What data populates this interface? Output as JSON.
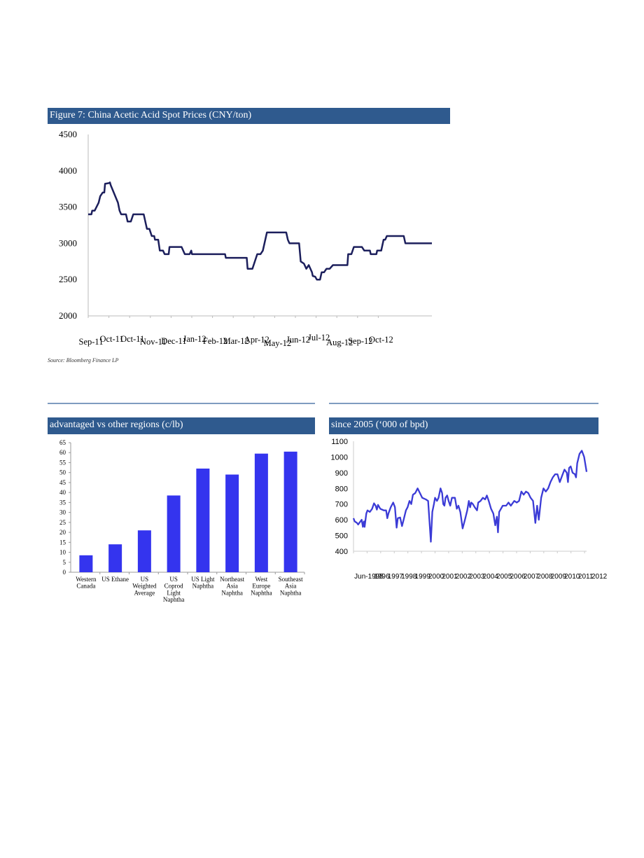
{
  "figure7": {
    "header": "Figure 7: China Acetic Acid Spot Prices (CNY/ton)",
    "source": "Source: Bloomberg Finance LP"
  },
  "figure_left": {
    "header": "advantaged vs other regions (c/lb)"
  },
  "figure_right": {
    "header": "since 2005 (‘000 of bpd)"
  },
  "colors": {
    "header": "#2f5a8e",
    "line_dark": "#1c1f5c",
    "bars": "#3434ee",
    "line_blue": "#3b3bd6"
  },
  "chart_data": [
    {
      "type": "line",
      "title": "Figure 7: China Acetic Acid Spot Prices (CNY/ton)",
      "ylim": [
        2000,
        4500
      ],
      "yticks": [
        2000,
        2500,
        3000,
        3500,
        4000,
        4500
      ],
      "xlim": [
        "2011-09-01",
        "2012-11-01"
      ],
      "xtick_labels": [
        "Sep-11",
        "Oct-11",
        "Oct-11",
        "Nov-11",
        "Dec-11",
        "Jan-12",
        "Feb-12",
        "Mar-12",
        "Apr-12",
        "May-12",
        "Jun-12",
        "Jul-12",
        "Aug-12",
        "Sep-12",
        "Oct-12"
      ],
      "grid": false,
      "points": [
        [
          "2011-09-01",
          3400
        ],
        [
          "2011-09-05",
          3400
        ],
        [
          "2011-09-06",
          3450
        ],
        [
          "2011-09-09",
          3450
        ],
        [
          "2011-09-14",
          3560
        ],
        [
          "2011-09-16",
          3650
        ],
        [
          "2011-09-19",
          3700
        ],
        [
          "2011-09-21",
          3700
        ],
        [
          "2011-09-22",
          3820
        ],
        [
          "2011-09-27",
          3830
        ],
        [
          "2011-09-28",
          3840
        ],
        [
          "2011-09-29",
          3800
        ],
        [
          "2011-10-08",
          3560
        ],
        [
          "2011-10-10",
          3450
        ],
        [
          "2011-10-12",
          3400
        ],
        [
          "2011-10-18",
          3400
        ],
        [
          "2011-10-20",
          3300
        ],
        [
          "2011-10-24",
          3300
        ],
        [
          "2011-10-27",
          3400
        ],
        [
          "2011-11-09",
          3400
        ],
        [
          "2011-11-13",
          3200
        ],
        [
          "2011-11-16",
          3200
        ],
        [
          "2011-11-19",
          3100
        ],
        [
          "2011-11-22",
          3100
        ],
        [
          "2011-11-23",
          3050
        ],
        [
          "2011-11-27",
          3050
        ],
        [
          "2011-11-29",
          2900
        ],
        [
          "2011-12-03",
          2900
        ],
        [
          "2011-12-05",
          2850
        ],
        [
          "2011-12-10",
          2850
        ],
        [
          "2011-12-11",
          2950
        ],
        [
          "2011-12-26",
          2950
        ],
        [
          "2011-12-30",
          2850
        ],
        [
          "2012-01-05",
          2850
        ],
        [
          "2012-01-07",
          2900
        ],
        [
          "2012-01-08",
          2850
        ],
        [
          "2012-02-18",
          2850
        ],
        [
          "2012-02-19",
          2800
        ],
        [
          "2012-03-16",
          2800
        ],
        [
          "2012-03-17",
          2650
        ],
        [
          "2012-03-23",
          2650
        ],
        [
          "2012-03-29",
          2850
        ],
        [
          "2012-04-02",
          2850
        ],
        [
          "2012-04-05",
          2900
        ],
        [
          "2012-04-10",
          3150
        ],
        [
          "2012-05-04",
          3150
        ],
        [
          "2012-05-06",
          3050
        ],
        [
          "2012-05-08",
          3000
        ],
        [
          "2012-05-20",
          3000
        ],
        [
          "2012-05-22",
          2750
        ],
        [
          "2012-05-26",
          2720
        ],
        [
          "2012-05-29",
          2650
        ],
        [
          "2012-06-01",
          2700
        ],
        [
          "2012-06-05",
          2600
        ],
        [
          "2012-06-06",
          2550
        ],
        [
          "2012-06-09",
          2540
        ],
        [
          "2012-06-11",
          2500
        ],
        [
          "2012-06-15",
          2500
        ],
        [
          "2012-06-17",
          2600
        ],
        [
          "2012-06-20",
          2600
        ],
        [
          "2012-06-23",
          2650
        ],
        [
          "2012-06-27",
          2650
        ],
        [
          "2012-07-01",
          2700
        ],
        [
          "2012-07-19",
          2700
        ],
        [
          "2012-07-20",
          2850
        ],
        [
          "2012-07-24",
          2850
        ],
        [
          "2012-07-27",
          2950
        ],
        [
          "2012-08-06",
          2950
        ],
        [
          "2012-08-09",
          2900
        ],
        [
          "2012-08-16",
          2900
        ],
        [
          "2012-08-17",
          2850
        ],
        [
          "2012-08-24",
          2850
        ],
        [
          "2012-08-25",
          2900
        ],
        [
          "2012-08-30",
          2900
        ],
        [
          "2012-09-02",
          3050
        ],
        [
          "2012-09-04",
          3050
        ],
        [
          "2012-09-06",
          3100
        ],
        [
          "2012-09-27",
          3100
        ],
        [
          "2012-09-29",
          3000
        ],
        [
          "2012-11-01",
          3000
        ]
      ]
    },
    {
      "type": "bar",
      "title": "advantaged vs other regions (c/lb)",
      "ylim": [
        0,
        65
      ],
      "yticks": [
        0,
        5,
        10,
        15,
        20,
        25,
        30,
        35,
        40,
        45,
        50,
        55,
        60,
        65
      ],
      "categories": [
        [
          "Western",
          "Canada"
        ],
        [
          "US Ethane"
        ],
        [
          "US",
          "Weighted",
          "Average"
        ],
        [
          "US",
          "Coprod",
          "Light",
          "Naphtha"
        ],
        [
          "US Light",
          "Naphtha"
        ],
        [
          "Northeast",
          "Asia",
          "Naphtha"
        ],
        [
          "West",
          "Europe",
          "Naphtha"
        ],
        [
          "Southeast",
          "Asia",
          "Naphtha"
        ]
      ],
      "values": [
        8.5,
        14,
        21,
        38.5,
        52,
        49,
        59.5,
        60.5
      ]
    },
    {
      "type": "line",
      "title": "since 2005 (‘000 of bpd)",
      "ylim": [
        400,
        1100
      ],
      "yticks": [
        400,
        500,
        600,
        700,
        800,
        900,
        1000,
        1100
      ],
      "xlim": [
        1995.4,
        2012.55
      ],
      "xtick_labels": [
        "Jun-1995",
        "1996",
        "1997",
        "1998",
        "1999",
        "2000",
        "2001",
        "2002",
        "2003",
        "2004",
        "2005",
        "2006",
        "2007",
        "2008",
        "2009",
        "2010",
        "2011",
        "2012"
      ],
      "points": [
        [
          1995.4,
          610
        ],
        [
          1995.49,
          590
        ],
        [
          1995.66,
          580
        ],
        [
          1995.74,
          570
        ],
        [
          1995.91,
          590
        ],
        [
          1996.0,
          600
        ],
        [
          1996.09,
          555
        ],
        [
          1996.17,
          590
        ],
        [
          1996.22,
          555
        ],
        [
          1996.34,
          640
        ],
        [
          1996.43,
          660
        ],
        [
          1996.6,
          650
        ],
        [
          1996.77,
          670
        ],
        [
          1996.91,
          705
        ],
        [
          1997.03,
          690
        ],
        [
          1997.12,
          665
        ],
        [
          1997.2,
          695
        ],
        [
          1997.37,
          670
        ],
        [
          1997.63,
          660
        ],
        [
          1997.8,
          660
        ],
        [
          1997.89,
          610
        ],
        [
          1997.97,
          640
        ],
        [
          1998.14,
          680
        ],
        [
          1998.32,
          710
        ],
        [
          1998.45,
          680
        ],
        [
          1998.57,
          550
        ],
        [
          1998.66,
          610
        ],
        [
          1998.83,
          615
        ],
        [
          1998.97,
          560
        ],
        [
          1999.09,
          600
        ],
        [
          1999.26,
          660
        ],
        [
          1999.38,
          680
        ],
        [
          1999.52,
          720
        ],
        [
          1999.65,
          700
        ],
        [
          1999.77,
          760
        ],
        [
          1999.94,
          770
        ],
        [
          2000.12,
          800
        ],
        [
          2000.29,
          770
        ],
        [
          2000.46,
          740
        ],
        [
          2000.72,
          730
        ],
        [
          2000.89,
          720
        ],
        [
          2001.09,
          460
        ],
        [
          2001.2,
          650
        ],
        [
          2001.32,
          700
        ],
        [
          2001.4,
          740
        ],
        [
          2001.54,
          720
        ],
        [
          2001.66,
          740
        ],
        [
          2001.8,
          800
        ],
        [
          2001.92,
          770
        ],
        [
          2002.0,
          700
        ],
        [
          2002.09,
          690
        ],
        [
          2002.17,
          740
        ],
        [
          2002.29,
          755
        ],
        [
          2002.4,
          720
        ],
        [
          2002.52,
          690
        ],
        [
          2002.64,
          740
        ],
        [
          2002.86,
          740
        ],
        [
          2003.0,
          670
        ],
        [
          2003.12,
          690
        ],
        [
          2003.26,
          650
        ],
        [
          2003.43,
          545
        ],
        [
          2003.6,
          600
        ],
        [
          2003.77,
          660
        ],
        [
          2003.89,
          720
        ],
        [
          2003.98,
          680
        ],
        [
          2004.06,
          710
        ],
        [
          2004.18,
          700
        ],
        [
          2004.32,
          680
        ],
        [
          2004.49,
          660
        ],
        [
          2004.58,
          710
        ],
        [
          2004.75,
          720
        ],
        [
          2004.92,
          740
        ],
        [
          2005.09,
          730
        ],
        [
          2005.21,
          755
        ],
        [
          2005.35,
          720
        ],
        [
          2005.52,
          670
        ],
        [
          2005.69,
          640
        ],
        [
          2005.83,
          565
        ],
        [
          2005.95,
          620
        ],
        [
          2006.03,
          520
        ],
        [
          2006.12,
          650
        ],
        [
          2006.38,
          690
        ],
        [
          2006.63,
          690
        ],
        [
          2006.8,
          710
        ],
        [
          2006.98,
          690
        ],
        [
          2007.06,
          700
        ],
        [
          2007.23,
          720
        ],
        [
          2007.41,
          710
        ],
        [
          2007.58,
          720
        ],
        [
          2007.75,
          780
        ],
        [
          2007.92,
          760
        ],
        [
          2008.09,
          780
        ],
        [
          2008.26,
          770
        ],
        [
          2008.43,
          740
        ],
        [
          2008.61,
          720
        ],
        [
          2008.78,
          580
        ],
        [
          2008.91,
          690
        ],
        [
          2009.03,
          600
        ],
        [
          2009.21,
          740
        ],
        [
          2009.38,
          800
        ],
        [
          2009.55,
          780
        ],
        [
          2009.72,
          800
        ],
        [
          2009.89,
          840
        ],
        [
          2010.06,
          870
        ],
        [
          2010.24,
          890
        ],
        [
          2010.41,
          890
        ],
        [
          2010.58,
          840
        ],
        [
          2010.75,
          880
        ],
        [
          2010.92,
          920
        ],
        [
          2011.09,
          900
        ],
        [
          2011.18,
          840
        ],
        [
          2011.26,
          930
        ],
        [
          2011.38,
          940
        ],
        [
          2011.52,
          900
        ],
        [
          2011.69,
          890
        ],
        [
          2011.77,
          870
        ],
        [
          2011.86,
          960
        ],
        [
          2012.03,
          1020
        ],
        [
          2012.2,
          1040
        ],
        [
          2012.37,
          1000
        ],
        [
          2012.55,
          905
        ]
      ]
    }
  ]
}
